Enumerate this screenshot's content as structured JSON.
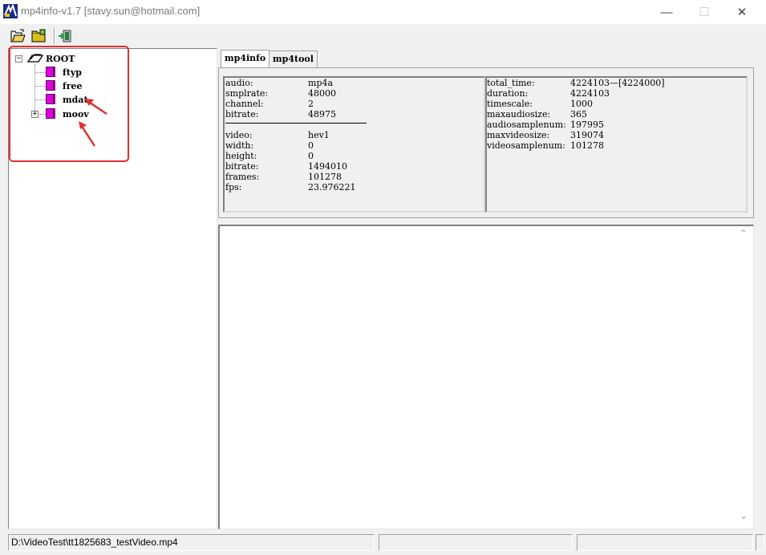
{
  "window": {
    "title": "mp4info-v1.7 [stavy.sun@hotmail.com]",
    "minimize_glyph": "—",
    "maximize_glyph": "☐",
    "close_glyph": "✕"
  },
  "toolbar": {
    "buttons": [
      {
        "name": "open-file-icon"
      },
      {
        "name": "open-folder-icon"
      },
      {
        "name": "exit-icon"
      }
    ]
  },
  "tree": {
    "root": {
      "label": "ROOT",
      "expand_glyph": "−"
    },
    "children": [
      {
        "label": "ftyp"
      },
      {
        "label": "free"
      },
      {
        "label": "mdat"
      },
      {
        "label": "moov",
        "expand_glyph": "+"
      }
    ]
  },
  "tabs": [
    {
      "label": "mp4info",
      "active": true
    },
    {
      "label": "mp4tool",
      "active": false
    }
  ],
  "info_left": {
    "audio": [
      {
        "key": "audio:",
        "value": "mp4a"
      },
      {
        "key": "smplrate:",
        "value": "48000"
      },
      {
        "key": "channel:",
        "value": "2"
      },
      {
        "key": "bitrate:",
        "value": "48975"
      }
    ],
    "video": [
      {
        "key": "video:",
        "value": "hev1"
      },
      {
        "key": "width:",
        "value": "0"
      },
      {
        "key": "height:",
        "value": "0"
      },
      {
        "key": "bitrate:",
        "value": "1494010"
      },
      {
        "key": "frames:",
        "value": "101278"
      },
      {
        "key": "fps:",
        "value": "23.976221"
      }
    ]
  },
  "info_right": [
    {
      "key": "total_time:",
      "value": "4224103—[4224000]"
    },
    {
      "key": "duration:",
      "value": "4224103"
    },
    {
      "key": "timescale:",
      "value": "1000"
    },
    {
      "key": "maxaudiosize:",
      "value": "365"
    },
    {
      "key": "audiosamplenum:",
      "value": "197995"
    },
    {
      "key": "maxvideosize:",
      "value": "319074"
    },
    {
      "key": "videosamplenum:",
      "value": "101278"
    }
  ],
  "scrollbar": {
    "up_glyph": "⌃",
    "down_glyph": "⌄"
  },
  "status": {
    "path": "D:\\VideoTest\\tt1825683_testVideo.mp4",
    "panel2": "",
    "panel3": "",
    "panel4": ""
  },
  "colors": {
    "annotation_red": "#e03030",
    "node_icon": "#e000e0"
  }
}
